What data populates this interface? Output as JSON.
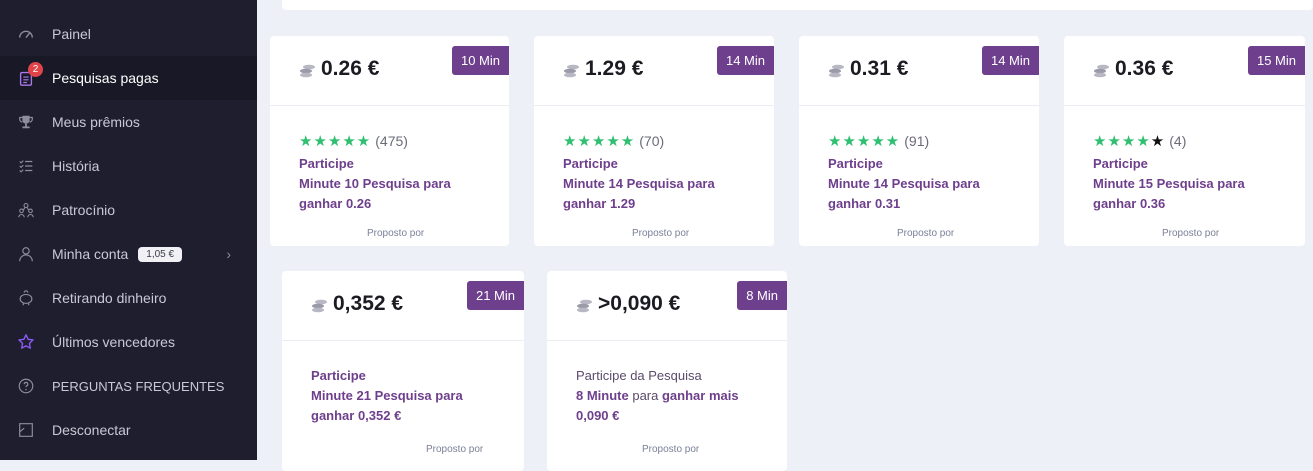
{
  "sidebar": {
    "items": [
      {
        "label": "Painel",
        "icon": "dashboard-icon"
      },
      {
        "label": "Pesquisas pagas",
        "icon": "clipboard-icon",
        "badge": "2",
        "active": true
      },
      {
        "label": "Meus prêmios",
        "icon": "trophy-icon"
      },
      {
        "label": "História",
        "icon": "list-check-icon"
      },
      {
        "label": "Patrocínio",
        "icon": "users-icon"
      },
      {
        "label": "Minha conta",
        "icon": "user-icon",
        "balance": "1,05 €"
      },
      {
        "label": "Retirando dinheiro",
        "icon": "piggy-bank-icon"
      },
      {
        "label": "Últimos vencedores",
        "icon": "star-icon"
      },
      {
        "label": "PERGUNTAS FREQUENTES",
        "icon": "question-icon"
      },
      {
        "label": "Desconectar",
        "icon": "logout-icon"
      }
    ],
    "accent_star": "#8a5cf6"
  },
  "cards": [
    {
      "price": "0.26 €",
      "time": "10 Min",
      "stars": 5,
      "rating_count": "(475)",
      "line1": "Participe",
      "line2": "Minute 10 Pesquisa para ganhar 0.26",
      "proposed": "Proposto por"
    },
    {
      "price": "1.29 €",
      "time": "14 Min",
      "stars": 5,
      "rating_count": "(70)",
      "line1": "Participe",
      "line2": "Minute 14 Pesquisa para ganhar 1.29",
      "proposed": "Proposto por"
    },
    {
      "price": "0.31 €",
      "time": "14 Min",
      "stars": 5,
      "rating_count": "(91)",
      "line1": "Participe",
      "line2": "Minute 14 Pesquisa para ganhar 0.31",
      "proposed": "Proposto por"
    },
    {
      "price": "0.36 €",
      "time": "15 Min",
      "stars": 4,
      "rating_count": "(4)",
      "line1": "Participe",
      "line2": "Minute 15 Pesquisa para ganhar 0.36",
      "proposed": "Proposto por"
    },
    {
      "price": "0,352 €",
      "time": "21 Min",
      "line1": "Participe",
      "line2": "Minute 21 Pesquisa para ganhar 0,352 €",
      "proposed": "Proposto por"
    },
    {
      "price": ">0,090 €",
      "time": "8 Min",
      "line1": "Participe da Pesquisa",
      "line2a": "8 Minute",
      "line2b": " para ",
      "line2c": "ganhar mais 0,090 €",
      "proposed": "Proposto por"
    }
  ],
  "colors": {
    "purple": "#6e3f8c",
    "green": "#2fbf71",
    "sidebar": "#1f1e2e"
  }
}
